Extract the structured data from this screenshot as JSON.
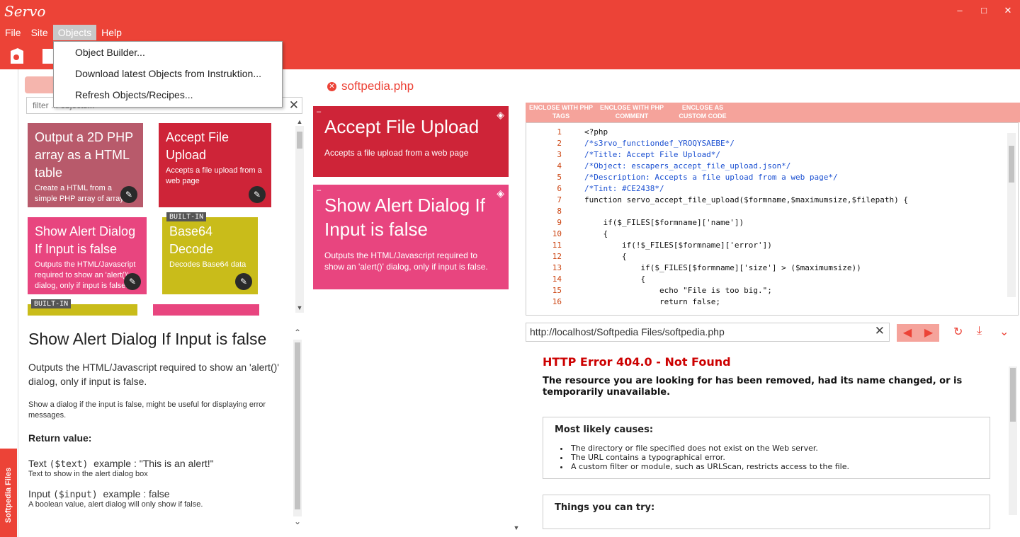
{
  "app": {
    "title": "Servo"
  },
  "window": {
    "minimize": "–",
    "maximize": "□",
    "close": "✕"
  },
  "menu": [
    "File",
    "Site",
    "Objects",
    "Help"
  ],
  "objects_menu": [
    "Object Builder...",
    "Download latest Objects from Instruktion...",
    "Refresh Objects/Recipes..."
  ],
  "filter": {
    "placeholder": "filter ... objects..."
  },
  "tiles": [
    {
      "title": "Output a 2D PHP array as a HTML table",
      "desc": "Create a HTML from a simple PHP array of arrays",
      "color": "#b85a6b"
    },
    {
      "title": "Accept File Upload",
      "desc": "Accepts a file upload from a web page",
      "color": "#ce2438"
    },
    {
      "title": "Show Alert Dialog If Input is false",
      "desc": "Outputs the HTML/Javascript required to show an 'alert()' dialog, only if input is false.",
      "color": "#e8457f"
    },
    {
      "title": "Base64 Decode",
      "desc": "Decodes Base64 data",
      "color": "#c9bc1a",
      "badge": "BUILT-IN"
    }
  ],
  "builtin_label": "BUILT-IN",
  "detail": {
    "title": "Show Alert Dialog If Input is false",
    "lead": "Outputs the HTML/Javascript required to show an 'alert()' dialog, only if input is false.",
    "note": "Show a dialog if the input is false, might be useful for displaying error messages.",
    "return_label": "Return value:",
    "params": [
      {
        "name": "Text",
        "code": "($text)",
        "example": "example : \"This is an alert!\"",
        "desc": "Text to show in the alert dialog box"
      },
      {
        "name": "Input",
        "code": "($input)",
        "example": "example : false",
        "desc": "A boolean value, alert dialog will only show if false."
      }
    ]
  },
  "side_tab": "Softpedia Files",
  "file_tab": "softpedia.php",
  "mid_tiles": [
    {
      "title": "Accept File Upload",
      "desc": "Accepts a file upload from a web page",
      "color": "#ce2438"
    },
    {
      "title": "Show Alert Dialog If Input is false",
      "desc": "Outputs the HTML/Javascript required to show an 'alert()' dialog, only if input is false.",
      "color": "#e8457f"
    }
  ],
  "enclose": [
    "ENCLOSE WITH PHP TAGS",
    "ENCLOSE WITH PHP COMMENT",
    "ENCLOSE AS CUSTOM CODE"
  ],
  "code": [
    "<?php",
    "/*s3rvo_functiondef_YROQYSAEBE*/",
    "/*Title: Accept File Upload*/",
    "/*Object: escapers_accept_file_upload.json*/",
    "/*Description: Accepts a file upload from a web page*/",
    "/*Tint: #CE2438*/",
    "function servo_accept_file_upload($formname,$maximumsize,$filepath) {",
    "",
    "    if($_FILES[$formname]['name'])",
    "    {",
    "        if(!$_FILES[$formname]['error'])",
    "        {",
    "            if($_FILES[$formname]['size'] > ($maximumsize))",
    "            {",
    "                echo \"File is too big.\";",
    "                return false;"
  ],
  "url": "http://localhost/Softpedia Files/softpedia.php",
  "browser": {
    "title": "HTTP Error 404.0 - Not Found",
    "subtitle": "The resource you are looking for has been removed, had its name changed, or is temporarily unavailable.",
    "causes_title": "Most likely causes:",
    "causes": [
      "The directory or file specified does not exist on the Web server.",
      "The URL contains a typographical error.",
      "A custom filter or module, such as URLScan, restricts access to the file."
    ],
    "try_title": "Things you can try:"
  }
}
